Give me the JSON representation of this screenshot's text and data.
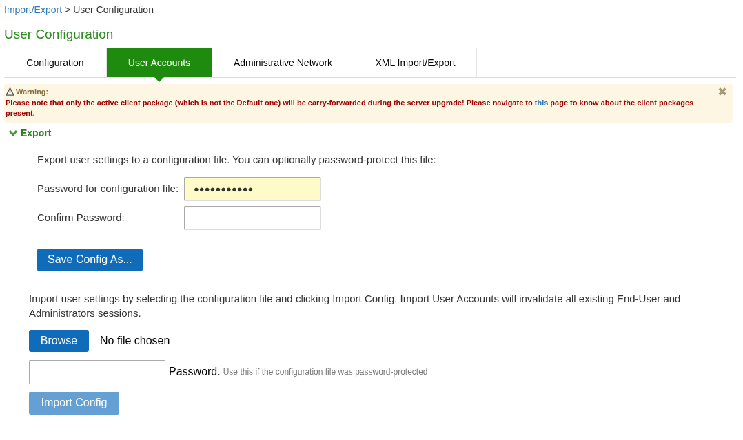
{
  "breadcrumb": {
    "link": "Import/Export",
    "separator": ">",
    "current": "User Configuration"
  },
  "page_title": "User Configuration",
  "tabs": [
    {
      "label": "Configuration",
      "selected": false
    },
    {
      "label": "User Accounts",
      "selected": true
    },
    {
      "label": "Administrative Network",
      "selected": false
    },
    {
      "label": "XML Import/Export",
      "selected": false
    }
  ],
  "warning": {
    "title": "Warning:",
    "text_before": "Please note that only the active client package (which is not the Default one) will be carry-forwarded during the server upgrade! Please navigate to",
    "link": "this",
    "text_after": "page to know about the client packages present.",
    "close": "✖"
  },
  "export_section": {
    "title": "Export",
    "expanded": true,
    "intro": "Export user settings to a configuration file. You can optionally password-protect this file:",
    "fields": [
      {
        "label": "Password for configuration file:",
        "value": "●●●●●●●●●●●",
        "highlighted": true
      },
      {
        "label": "Confirm Password:",
        "highlighted": false
      }
    ],
    "save_button": "Save Config As..."
  },
  "import_section": {
    "intro": "Import user settings by selecting the configuration file and clicking Import Config. Import User Accounts will invalidate all existing End-User and Administrators sessions.",
    "browse_button": "Browse",
    "file_status": "No file chosen",
    "password_label": "Password.",
    "password_hint": "Use this if the configuration file was password-protected",
    "import_button": {
      "label": "Import Config",
      "disabled": true
    }
  }
}
